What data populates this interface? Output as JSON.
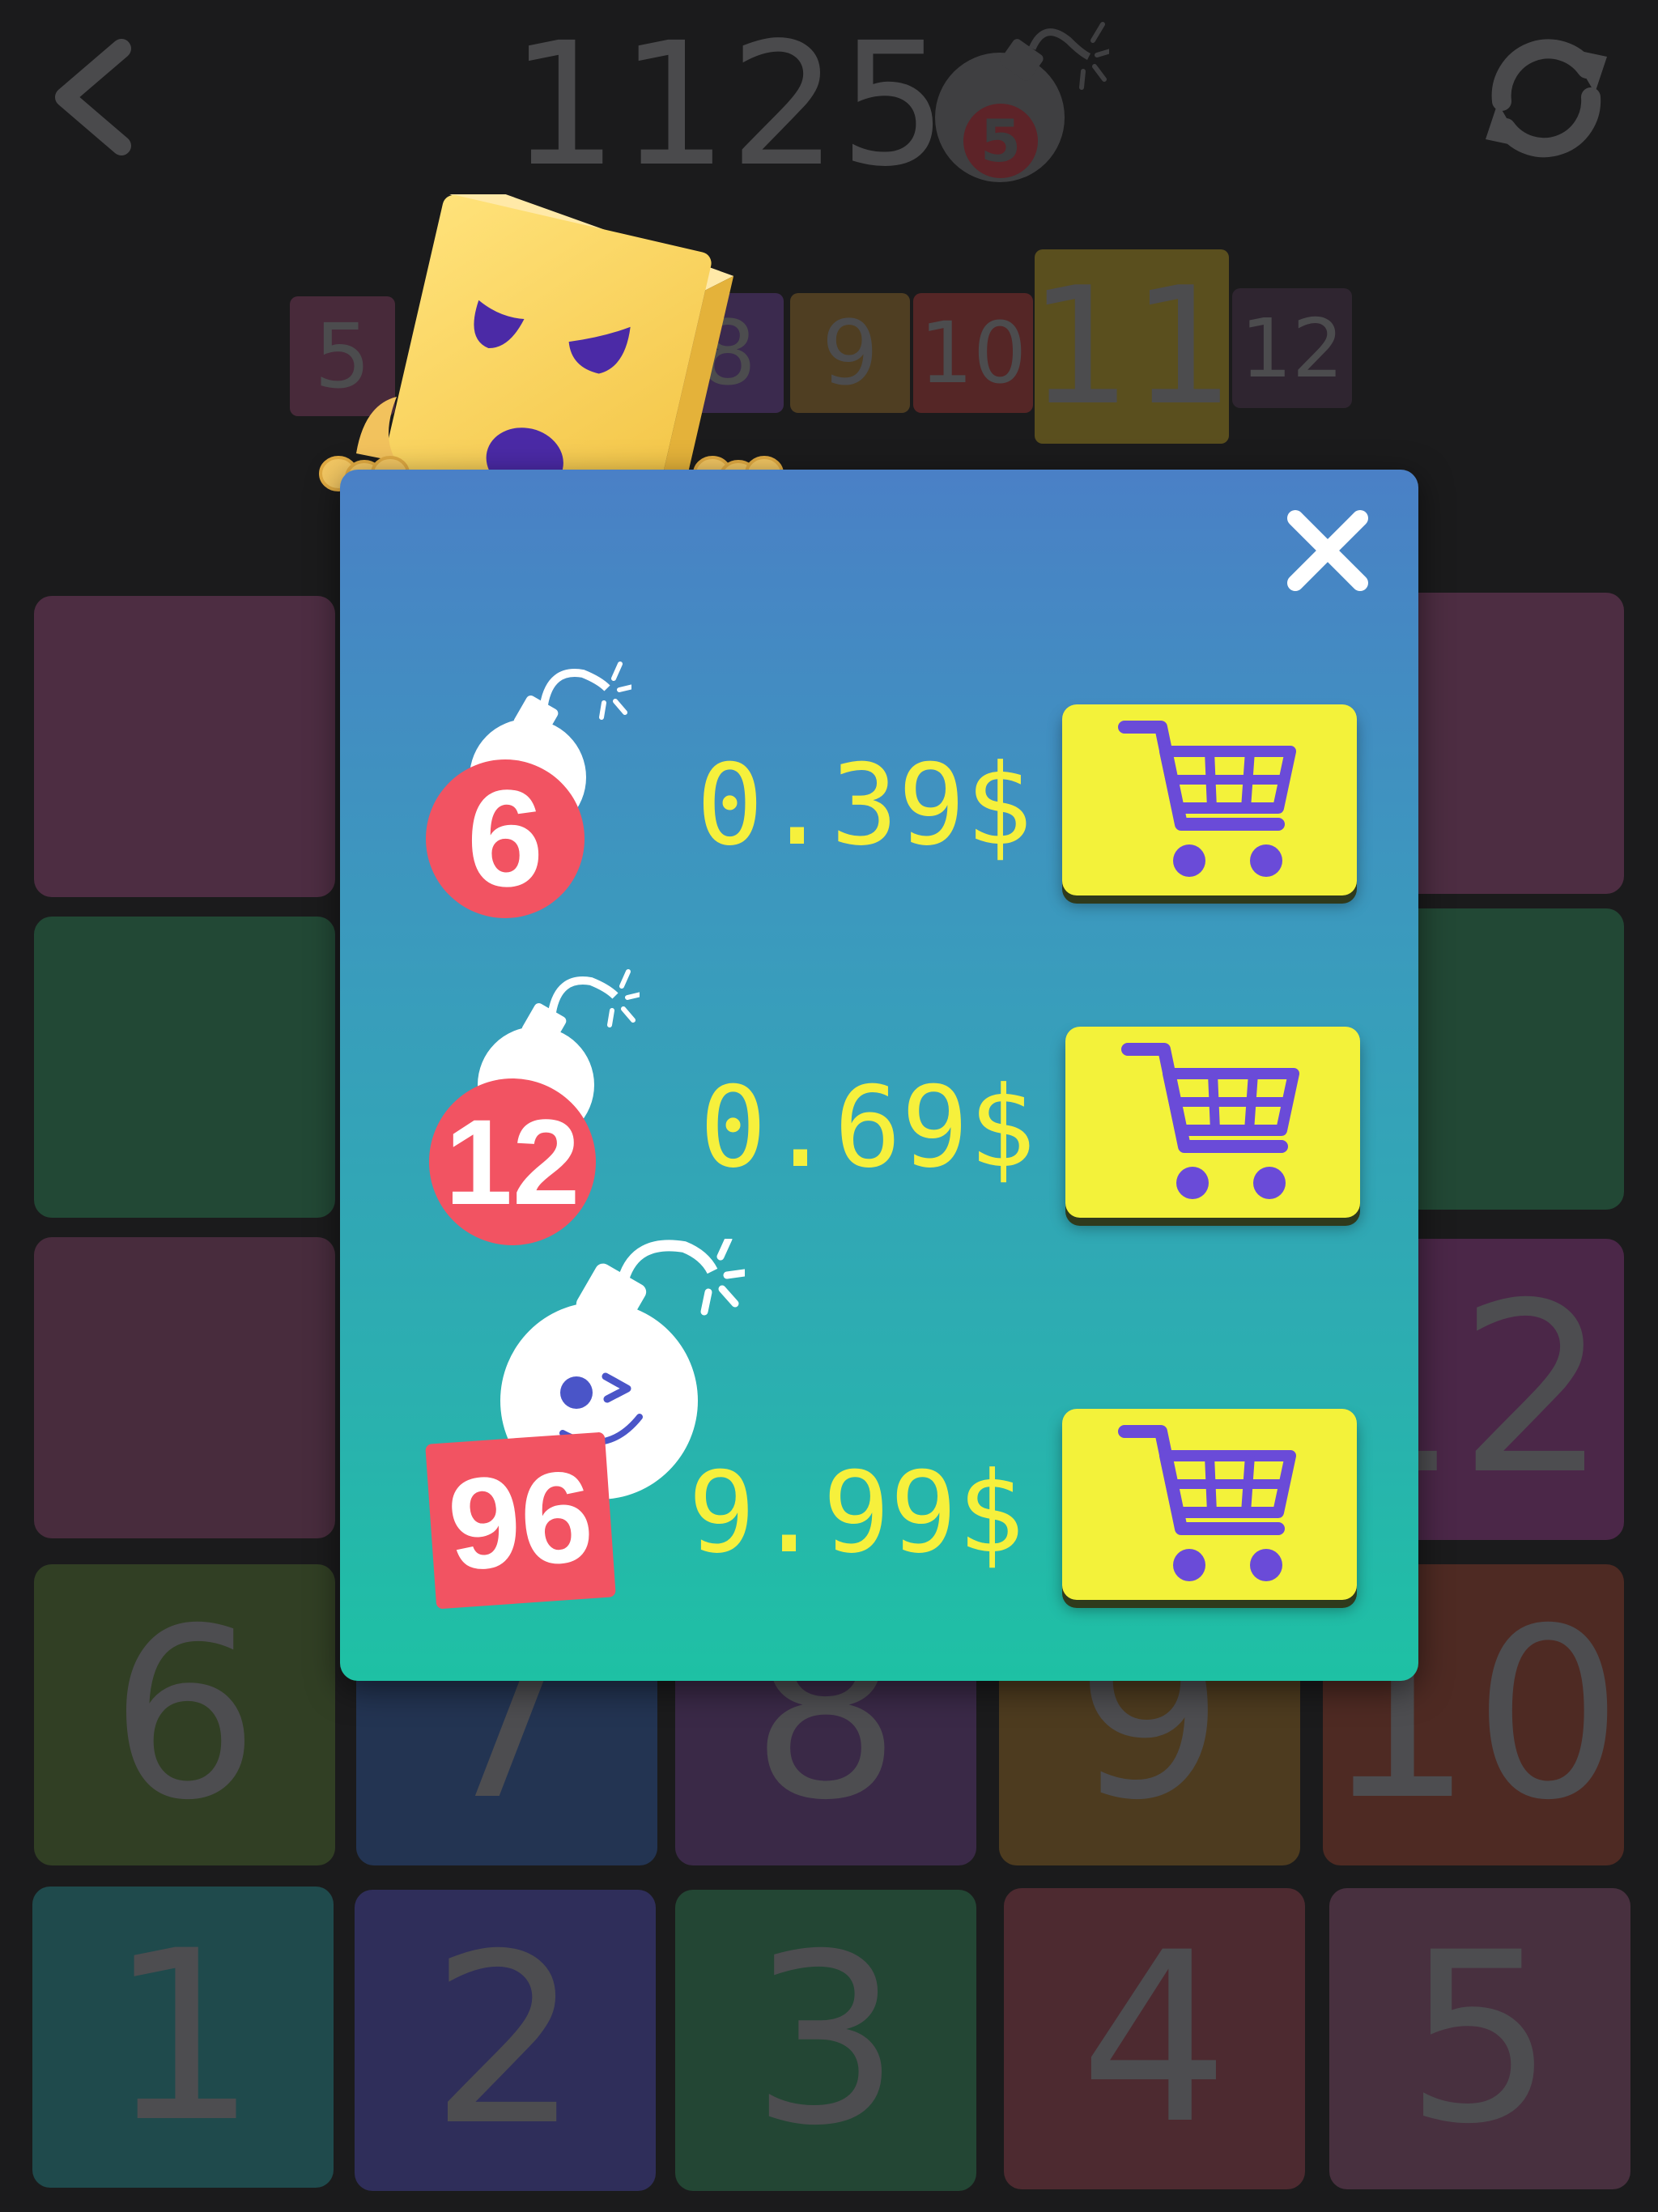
{
  "header": {
    "score": "1125",
    "bomb_count": "5",
    "back_icon": "chevron-left-icon",
    "restart_icon": "refresh-icon"
  },
  "level_strip": [
    "5",
    "8",
    "9",
    "10",
    "11",
    "12"
  ],
  "board": {
    "rows": [
      [
        "",
        "",
        "",
        "",
        ""
      ],
      [
        "",
        "",
        "",
        "",
        ""
      ],
      [
        "",
        "",
        "",
        "",
        "12"
      ],
      [
        "6",
        "7",
        "8",
        "9",
        "10"
      ],
      [
        "1",
        "2",
        "3",
        "4",
        "5"
      ]
    ]
  },
  "shop": {
    "close_icon": "close-icon",
    "offers": [
      {
        "bombs": "6",
        "price": "0.39$",
        "cart_icon": "cart-icon"
      },
      {
        "bombs": "12",
        "price": "0.69$",
        "cart_icon": "cart-icon"
      },
      {
        "bombs": "96",
        "price": "9.99$",
        "cart_icon": "cart-icon"
      }
    ]
  },
  "colors": {
    "background": "#1b1b1c",
    "price_text": "#f6f03c",
    "cart_button": "#f3f23a",
    "cart_icon": "#6a4bd8",
    "badge": "#f25362",
    "modal_top": "#4a80c6",
    "modal_bottom": "#1ec1a4"
  }
}
